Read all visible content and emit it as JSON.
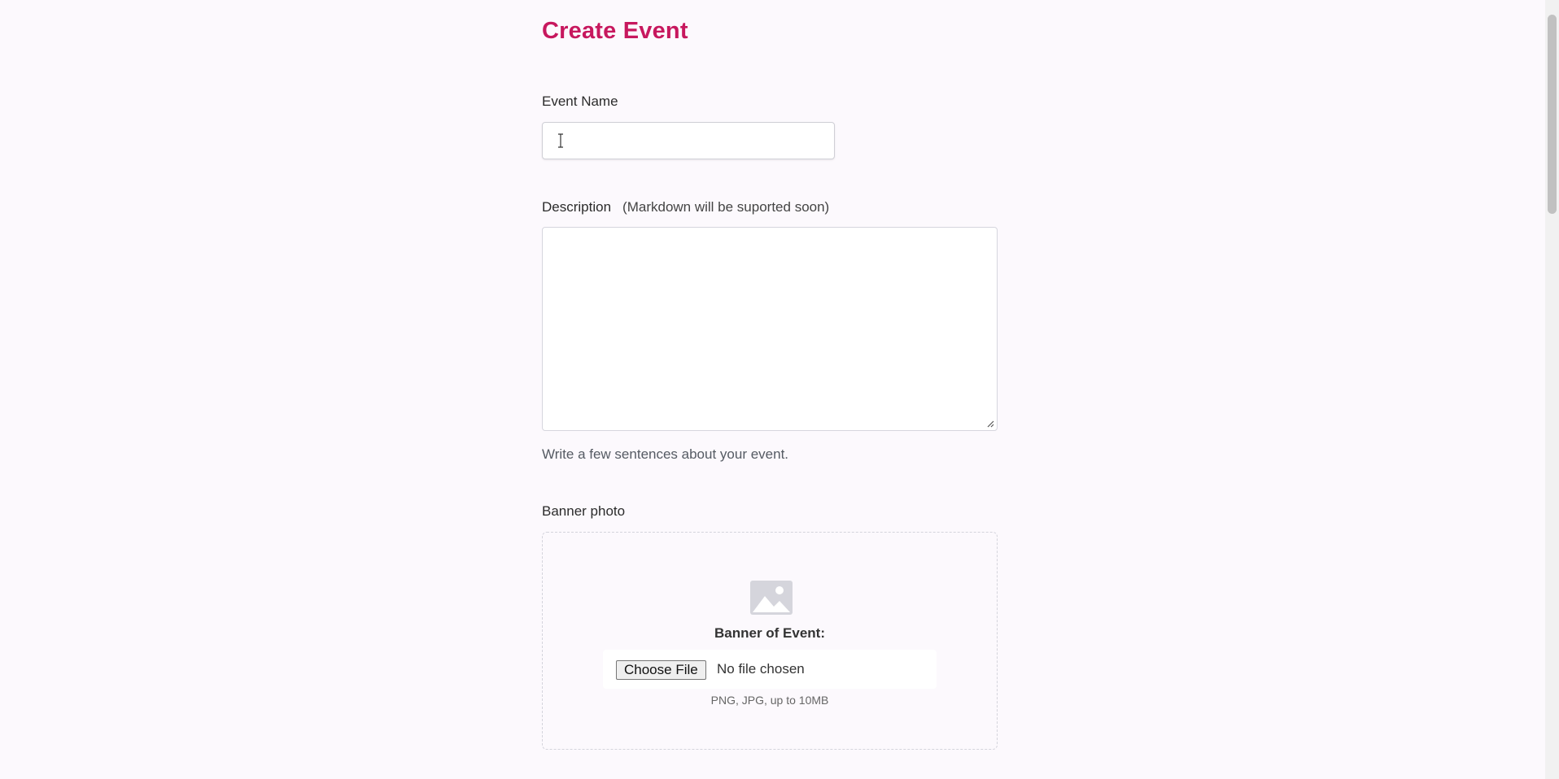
{
  "header": {
    "title": "Create Event"
  },
  "event_name": {
    "label": "Event Name",
    "value": "",
    "placeholder": ""
  },
  "description": {
    "label": "Description",
    "hint": "(Markdown will be suported soon)",
    "value": "",
    "helper": "Write a few sentences about your event."
  },
  "banner": {
    "label": "Banner photo",
    "dropzone_title": "Banner of Event:",
    "choose_file_label": "Choose File",
    "no_file_text": "No file chosen",
    "file_types": "PNG, JPG, up to 10MB",
    "icon": "image-icon"
  },
  "colors": {
    "accent": "#c7185e",
    "background": "#fcf9fd"
  }
}
